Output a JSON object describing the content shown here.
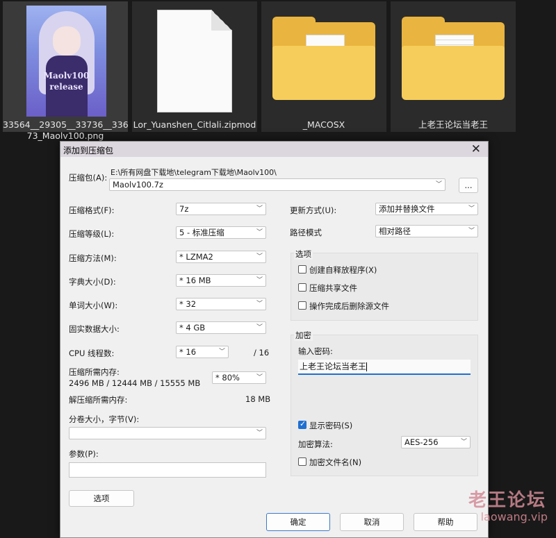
{
  "explorer": {
    "files": [
      {
        "name": "33564_29305_33736_33673_Maolv100.png",
        "line1": "33564__29305__33736__336",
        "line2": "73_Maolv100.png",
        "thumb_text_1": "Maolv100",
        "thumb_text_2": "release",
        "kind": "image"
      },
      {
        "name": "Lor_Yuanshen_Citlali.zipmod",
        "kind": "document"
      },
      {
        "name": "_MACOSX",
        "kind": "folder"
      },
      {
        "name": "上老王论坛当老王",
        "kind": "folder"
      }
    ]
  },
  "dialog": {
    "title": "添加到压缩包",
    "archive_label": "压缩包(A):",
    "archive_path": "E:\\所有网盘下载地\\telegram下载地\\Maolv100\\",
    "archive_name": "Maolv100.7z",
    "browse_label": "...",
    "left": {
      "format_label": "压缩格式(F):",
      "format_value": "7z",
      "level_label": "压缩等级(L):",
      "level_value": "5 - 标准压缩",
      "method_label": "压缩方法(M):",
      "method_value": "* LZMA2",
      "dict_label": "字典大小(D):",
      "dict_value": "* 16 MB",
      "word_label": "单词大小(W):",
      "word_value": "* 32",
      "solid_label": "固实数据大小:",
      "solid_value": "* 4 GB",
      "threads_label": "CPU 线程数:",
      "threads_value": "* 16",
      "threads_total": "/ 16",
      "mem_comp_label": "压缩所需内存:",
      "mem_comp_values": "2496 MB / 12444 MB / 15555 MB",
      "mem_comp_percent": "* 80%",
      "mem_decomp_label": "解压缩所需内存:",
      "mem_decomp_value": "18 MB",
      "split_label": "分卷大小，字节(V):",
      "params_label": "参数(P):",
      "options_button": "选项"
    },
    "right": {
      "update_label": "更新方式(U):",
      "update_value": "添加并替换文件",
      "path_label": "路径模式",
      "path_value": "相对路径",
      "options_group": "选项",
      "sfx_label": "创建自释放程序(X)",
      "sfx_checked": false,
      "shared_label": "压缩共享文件",
      "shared_checked": false,
      "delete_label": "操作完成后删除源文件",
      "delete_checked": false,
      "encrypt_group": "加密",
      "password_label": "输入密码:",
      "password_value": "上老王论坛当老王",
      "show_password_label": "显示密码(S)",
      "show_password_checked": true,
      "algo_label": "加密算法:",
      "algo_value": "AES-256",
      "encrypt_names_label": "加密文件名(N)",
      "encrypt_names_checked": false
    },
    "buttons": {
      "ok": "确定",
      "cancel": "取消",
      "help": "帮助"
    }
  },
  "watermark": {
    "cn": "老王论坛",
    "url": "laowang.vip"
  },
  "colors": {
    "accent": "#1f6fd1",
    "folder": "#e9b43f",
    "background": "#191919"
  }
}
